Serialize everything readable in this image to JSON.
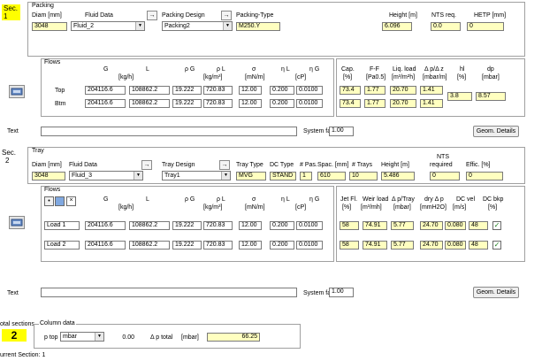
{
  "section1": {
    "sec_label": "Sec.",
    "sec_number": "1",
    "packing_title": "Packing",
    "diam_label": "Diam [mm]",
    "fluid_label": "Fluid Data",
    "packing_design_label": "Packing Design",
    "packing_type_label": "Packing-Type",
    "height_label": "Height [m]",
    "nts_label": "NTS req.",
    "hetp_label": "HETP [mm]",
    "diam_value": "3048",
    "fluid_value": "Fluid_2",
    "packing_design_value": "Packing2",
    "packing_type_value": "M250.Y",
    "height_value": "6.096",
    "nts_value": "0.0",
    "hetp_value": "0",
    "flows_label": "Flows",
    "col_G": "G",
    "col_L": "L",
    "col_kgh": "[kg/h]",
    "col_rhoG": "ρ G",
    "col_rhoL": "ρ L",
    "col_kgm3": "[kg/m³]",
    "col_sigma": "σ",
    "col_mNm": "[mN/m]",
    "col_etaL": "η L",
    "col_etaG": "η G",
    "col_cP": "[cP]",
    "col_cap": "Cap.",
    "col_cap_unit": "[%]",
    "col_ff": "F-F",
    "col_ff_unit": "[Pa0.5]",
    "col_liq": "Liq. load",
    "col_liq_unit": "[m³/m²h]",
    "col_dpz": "Δ p/Δ z",
    "col_dpz_unit": "[mbar/m]",
    "col_hl": "hl",
    "col_hl_unit": "[%]",
    "col_dp": "dp",
    "col_dp_unit": "[mbar]",
    "rows": [
      {
        "label": "Top",
        "G": "204116.6",
        "L": "108862.2",
        "rhoG": "19.222",
        "rhoL": "720.83",
        "sigma": "12.00",
        "etaL": "0.200",
        "etaG": "0.0100",
        "cap": "73.4",
        "ff": "1.77",
        "liq": "20.70",
        "dpz": "1.41"
      },
      {
        "label": "Btm",
        "G": "204116.6",
        "L": "108862.2",
        "rhoG": "19.222",
        "rhoL": "720.83",
        "sigma": "12.00",
        "etaL": "0.200",
        "etaG": "0.0100",
        "cap": "73.4",
        "ff": "1.77",
        "liq": "20.70",
        "dpz": "1.41"
      }
    ],
    "hl_value": "3.8",
    "dp_value": "8.57",
    "text_label": "Text",
    "system_factor_label": "System factor",
    "system_factor_value": "1.00",
    "geom_button": "Geom. Details"
  },
  "section2": {
    "sec_label": "Sec.",
    "sec_number": "2",
    "tray_title": "Tray",
    "diam_label": "Diam [mm]",
    "fluid_label": "Fluid Data",
    "tray_design_label": "Tray Design",
    "tray_type_label": "Tray Type",
    "dc_type_label": "DC Type",
    "pas_label": "# Pas.",
    "spac_label": "Spac. [mm]",
    "trays_label": "# Trays",
    "height_label": "Height [m]",
    "nts_label_top": "NTS",
    "nts_label": "required",
    "effic_label": "Effic. [%]",
    "diam_value": "3048",
    "fluid_value": "Fluid_3",
    "tray_design_value": "Tray1",
    "tray_type_value": "MVG",
    "dc_type_value": "STAND",
    "pas_value": "1",
    "spac_value": "610",
    "trays_value": "10",
    "height_value": "5.486",
    "nts_value": "0",
    "effic_value": "0",
    "flows_label": "Flows",
    "col_G": "G",
    "col_L": "L",
    "col_kgh": "[kg/h]",
    "col_rhoG": "ρ G",
    "col_rhoL": "ρ L",
    "col_kgm3": "[kg/m³]",
    "col_sigma": "σ",
    "col_mNm": "[mN/m]",
    "col_etaL": "η L",
    "col_etaG": "η G",
    "col_cP": "[cP]",
    "col_jetfl": "Jet Fl.",
    "col_jetfl_unit": "[%]",
    "col_weir": "Weir load",
    "col_weir_unit": "[m³/mh]",
    "col_dptray": "Δ p/Tray",
    "col_dptray_unit": "[mbar]",
    "col_dry": "dry Δ p",
    "col_dry_unit": "[mmH2O]",
    "col_dcvel": "DC vel",
    "col_dcvel_unit": "[m/s]",
    "col_dcbkp": "DC bkp",
    "col_dcbkp_unit": "[%]",
    "rows": [
      {
        "label": "Load 1",
        "G": "204116.6",
        "L": "108862.2",
        "rhoG": "19.222",
        "rhoL": "720.83",
        "sigma": "12.00",
        "etaL": "0.200",
        "etaG": "0.0100",
        "jet": "58",
        "weir": "74.91",
        "dptray": "5.77",
        "dry": "24.70",
        "dcvel": "0.080",
        "dcbkp": "48"
      },
      {
        "label": "Load 2",
        "G": "204116.6",
        "L": "108862.2",
        "rhoG": "19.222",
        "rhoL": "720.83",
        "sigma": "12.00",
        "etaL": "0.200",
        "etaG": "0.0100",
        "jet": "58",
        "weir": "74.91",
        "dptray": "5.77",
        "dry": "24.70",
        "dcvel": "0.080",
        "dcbkp": "48"
      }
    ],
    "text_label": "Text",
    "system_factor_label": "System factor",
    "system_factor_value": "1.00",
    "geom_button": "Geom. Details"
  },
  "footer": {
    "total_sections_label": "otal sections",
    "total_sections_value": "2",
    "column_data_label": "Column data",
    "ptop_label": "p top",
    "ptop_unit": "mbar",
    "ptop_value": "0.00",
    "ptotal_label": "Δ p total",
    "ptotal_unit": "[mbar]",
    "ptotal_value": "66.25",
    "current_section": "urrent Section: 1"
  },
  "colors": {
    "yellow_input": "#ffffc0",
    "sec_highlight": "#ffff00",
    "panel_border": "#a0a0a0"
  },
  "icons": [
    "arrow-right-icon",
    "column-icon",
    "dropdown-arrow-icon",
    "checkmark-icon",
    "add-icon",
    "delete-icon"
  ]
}
